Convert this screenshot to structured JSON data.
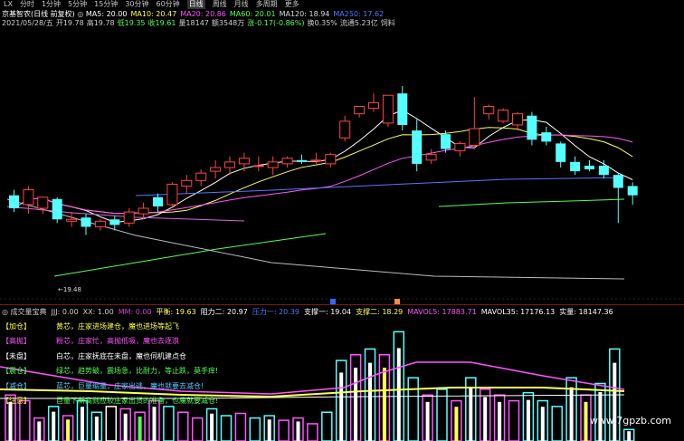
{
  "toolbar": {
    "items": [
      "分时",
      "1分钟",
      "5分钟",
      "15分钟",
      "30分钟",
      "60分钟",
      "日线",
      "周线",
      "月线",
      "多周期",
      "更多"
    ],
    "active_index": 6,
    "prefix": "LX"
  },
  "header": {
    "stock": "京基智农(日线 前复权)",
    "ma": [
      {
        "text": "MA5: 20.00",
        "color": "#ffffff"
      },
      {
        "text": "MA10: 20.47",
        "color": "#ffff55"
      },
      {
        "text": "MA20: 20.86",
        "color": "#ff55ff"
      },
      {
        "text": "MA60: 20.01",
        "color": "#55ff55"
      },
      {
        "text": "MA120: 18.94",
        "color": "#dddddd"
      },
      {
        "text": "MA250: 17.62",
        "color": "#5577ff"
      }
    ],
    "quote_line": [
      {
        "text": "2021/05/28/五",
        "color": "#cccccc"
      },
      {
        "text": "开19.78",
        "color": "#cccccc"
      },
      {
        "text": "高19.78",
        "color": "#cccccc"
      },
      {
        "text": "低19.35",
        "color": "#55ff55"
      },
      {
        "text": "收19.61",
        "color": "#55ff55"
      },
      {
        "text": "量18147",
        "color": "#cccccc"
      },
      {
        "text": "额3548万",
        "color": "#cccccc"
      },
      {
        "text": "涨-0.17(-0.86%)",
        "color": "#55ff55"
      },
      {
        "text": "换0.35%",
        "color": "#cccccc"
      },
      {
        "text": "流通5.23亿",
        "color": "#cccccc"
      },
      {
        "text": "饲料",
        "color": "#cccccc"
      }
    ],
    "min_label": "←19.48"
  },
  "volume_header": [
    {
      "text": "成交量宝典",
      "color": "#cccccc"
    },
    {
      "text": "JJJ: 0.00",
      "color": "#cccccc"
    },
    {
      "text": "XX: 1.00",
      "color": "#cccccc"
    },
    {
      "text": "MM: 0.00",
      "color": "#cc44cc"
    },
    {
      "text": "平衡: 19.63",
      "color": "#ffff55"
    },
    {
      "text": "阻力二: 20.97",
      "color": "#ffffff"
    },
    {
      "text": "压力一: 20.39",
      "color": "#5577ff"
    },
    {
      "text": "支撑一: 19.04",
      "color": "#ffffff"
    },
    {
      "text": "支撑二: 18.29",
      "color": "#ffff55"
    },
    {
      "text": "MAVOL5: 17883.71",
      "color": "#ff55ff"
    },
    {
      "text": "MAVOL35: 17176.13",
      "color": "#ffffff"
    },
    {
      "text": "实量: 18147.36",
      "color": "#ffffff"
    }
  ],
  "legend": [
    {
      "key": "【加仓】",
      "key_color": "#ffff44",
      "desc": "黄芯，庄家进场建仓，魔也进场等起飞",
      "desc_color": "#ffff44"
    },
    {
      "key": "【高抛】",
      "key_color": "#ff55ff",
      "desc": "粉芯，庄家忙，高抛低吸，魔也去逐浪",
      "desc_color": "#ff55ff"
    },
    {
      "key": "【未盘】",
      "key_color": "#ffffff",
      "desc": "白芯，庄家抚底在未盘，魔也伺机建点仓",
      "desc_color": "#ffffff"
    },
    {
      "key": "【震仓】",
      "key_color": "#55ff55",
      "desc": "绿芯，趋势破，震场急，比耐力，等止跌，莫手痒!",
      "desc_color": "#55ff55"
    },
    {
      "key": "【减仓】",
      "key_color": "#55ccff",
      "desc": "蓝芯，巨量缩量，庄家出逃，魔也就要去减仓!",
      "desc_color": "#55ccff"
    },
    {
      "key": "【注意】",
      "key_color": "#ffff44",
      "desc": "巨量下新高则应较庄家出货的准备，也魔就要减仓!",
      "desc_color": "#55ff55"
    }
  ],
  "watermark": "www.7gpzb.com",
  "colors": {
    "up": "#ff4444",
    "down": "#55ffff",
    "ma5": "#ffffff",
    "ma10": "#ffff55",
    "ma20": "#ff55ff",
    "ma60": "#55ff55",
    "ma120": "#dddddd",
    "ma250": "#5577ff"
  },
  "price_axis": {
    "min": 18.0,
    "max": 23.5
  },
  "candles": [
    {
      "o": 20.55,
      "h": 20.7,
      "c": 20.2,
      "l": 20.1
    },
    {
      "o": 20.3,
      "h": 20.8,
      "c": 20.7,
      "l": 20.05
    },
    {
      "o": 20.2,
      "h": 20.45,
      "c": 20.5,
      "l": 20.05
    },
    {
      "o": 20.45,
      "h": 20.5,
      "c": 19.9,
      "l": 19.8
    },
    {
      "o": 19.85,
      "h": 20.1,
      "c": 19.9,
      "l": 19.7
    },
    {
      "o": 19.95,
      "h": 20.05,
      "c": 19.7,
      "l": 19.48
    },
    {
      "o": 19.7,
      "h": 19.9,
      "c": 19.85,
      "l": 19.6
    },
    {
      "o": 19.9,
      "h": 20.0,
      "c": 19.75,
      "l": 19.6
    },
    {
      "o": 19.8,
      "h": 20.2,
      "c": 20.1,
      "l": 19.7
    },
    {
      "o": 20.05,
      "h": 20.35,
      "c": 20.2,
      "l": 19.9
    },
    {
      "o": 20.5,
      "h": 20.6,
      "c": 20.25,
      "l": 20.1
    },
    {
      "o": 20.3,
      "h": 20.9,
      "c": 20.85,
      "l": 20.2
    },
    {
      "o": 20.8,
      "h": 21.1,
      "c": 20.95,
      "l": 20.6
    },
    {
      "o": 20.95,
      "h": 21.25,
      "c": 21.15,
      "l": 20.8
    },
    {
      "o": 21.2,
      "h": 21.5,
      "c": 21.3,
      "l": 21.0
    },
    {
      "o": 21.3,
      "h": 21.6,
      "c": 21.45,
      "l": 21.1
    },
    {
      "o": 21.4,
      "h": 21.7,
      "c": 21.55,
      "l": 21.2
    },
    {
      "o": 21.35,
      "h": 21.6,
      "c": 21.35,
      "l": 21.2
    },
    {
      "o": 21.3,
      "h": 21.6,
      "c": 21.45,
      "l": 21.1
    },
    {
      "o": 21.4,
      "h": 21.6,
      "c": 21.55,
      "l": 21.3
    },
    {
      "o": 21.5,
      "h": 21.65,
      "c": 21.45,
      "l": 21.4
    },
    {
      "o": 21.5,
      "h": 21.7,
      "c": 21.5,
      "l": 21.4
    },
    {
      "o": 21.4,
      "h": 21.7,
      "c": 21.65,
      "l": 21.3
    },
    {
      "o": 22.1,
      "h": 22.7,
      "c": 22.55,
      "l": 22.0
    },
    {
      "o": 22.75,
      "h": 22.9,
      "c": 22.95,
      "l": 22.65
    },
    {
      "o": 22.9,
      "h": 23.3,
      "c": 23.05,
      "l": 22.8
    },
    {
      "o": 22.5,
      "h": 23.1,
      "c": 23.25,
      "l": 22.4
    },
    {
      "o": 23.3,
      "h": 23.5,
      "c": 22.45,
      "l": 22.3
    },
    {
      "o": 22.3,
      "h": 22.6,
      "c": 21.4,
      "l": 21.2
    },
    {
      "o": 21.5,
      "h": 21.8,
      "c": 21.65,
      "l": 21.4
    },
    {
      "o": 22.2,
      "h": 22.3,
      "c": 21.8,
      "l": 21.7
    },
    {
      "o": 21.75,
      "h": 22.0,
      "c": 21.95,
      "l": 21.6
    },
    {
      "o": 21.9,
      "h": 23.2,
      "c": 22.35,
      "l": 21.8
    },
    {
      "o": 22.75,
      "h": 23.0,
      "c": 22.95,
      "l": 22.6
    },
    {
      "o": 22.55,
      "h": 22.9,
      "c": 22.85,
      "l": 22.5
    },
    {
      "o": 22.45,
      "h": 22.8,
      "c": 22.75,
      "l": 22.3
    },
    {
      "o": 22.7,
      "h": 22.8,
      "c": 22.05,
      "l": 21.9
    },
    {
      "o": 22.25,
      "h": 22.4,
      "c": 22.0,
      "l": 21.9
    },
    {
      "o": 21.95,
      "h": 22.0,
      "c": 21.45,
      "l": 21.3
    },
    {
      "o": 21.45,
      "h": 21.6,
      "c": 21.2,
      "l": 21.1
    },
    {
      "o": 21.35,
      "h": 21.5,
      "c": 21.25,
      "l": 21.2
    },
    {
      "o": 21.35,
      "h": 21.5,
      "c": 21.1,
      "l": 21.0
    },
    {
      "o": 21.1,
      "h": 21.15,
      "c": 20.75,
      "l": 19.8
    },
    {
      "o": 20.8,
      "h": 20.9,
      "c": 20.55,
      "l": 20.3
    }
  ],
  "volumes": [
    {
      "v": 0.4,
      "kind": "magenta",
      "core": "white"
    },
    {
      "v": 0.35,
      "kind": "magenta",
      "core": "none"
    },
    {
      "v": 0.2,
      "kind": "magenta",
      "core": "white"
    },
    {
      "v": 0.3,
      "kind": "cyan",
      "core": "white"
    },
    {
      "v": 0.22,
      "kind": "magenta",
      "core": "yellow"
    },
    {
      "v": 0.35,
      "kind": "cyan",
      "core": "white"
    },
    {
      "v": 0.25,
      "kind": "cyan",
      "core": "white"
    },
    {
      "v": 0.3,
      "kind": "white",
      "core": "none"
    },
    {
      "v": 0.28,
      "kind": "magenta",
      "core": "white"
    },
    {
      "v": 0.25,
      "kind": "magenta",
      "core": "green"
    },
    {
      "v": 0.35,
      "kind": "magenta",
      "core": "white"
    },
    {
      "v": 0.3,
      "kind": "cyan",
      "core": "none"
    },
    {
      "v": 0.25,
      "kind": "magenta",
      "core": "none"
    },
    {
      "v": 0.2,
      "kind": "magenta",
      "core": "none"
    },
    {
      "v": 0.28,
      "kind": "cyan",
      "core": "white"
    },
    {
      "v": 0.22,
      "kind": "cyan",
      "core": "none"
    },
    {
      "v": 0.24,
      "kind": "magenta",
      "core": "none"
    },
    {
      "v": 0.2,
      "kind": "cyan",
      "core": "none"
    },
    {
      "v": 0.22,
      "kind": "cyan",
      "core": "white"
    },
    {
      "v": 0.18,
      "kind": "magenta",
      "core": "none"
    },
    {
      "v": 0.2,
      "kind": "magenta",
      "core": "white"
    },
    {
      "v": 0.15,
      "kind": "magenta",
      "core": "none"
    },
    {
      "v": 0.25,
      "kind": "cyan",
      "core": "none"
    },
    {
      "v": 0.7,
      "kind": "cyan",
      "core": "white"
    },
    {
      "v": 0.75,
      "kind": "magenta",
      "core": "white"
    },
    {
      "v": 0.8,
      "kind": "cyan",
      "core": "white"
    },
    {
      "v": 0.75,
      "kind": "magenta",
      "core": "yellow"
    },
    {
      "v": 0.95,
      "kind": "cyan",
      "core": "white"
    },
    {
      "v": 0.55,
      "kind": "cyan",
      "core": "none"
    },
    {
      "v": 0.4,
      "kind": "magenta",
      "core": "white"
    },
    {
      "v": 0.45,
      "kind": "cyan",
      "core": "none"
    },
    {
      "v": 0.35,
      "kind": "magenta",
      "core": "yellow"
    },
    {
      "v": 0.55,
      "kind": "cyan",
      "core": "white"
    },
    {
      "v": 0.45,
      "kind": "magenta",
      "core": "white"
    },
    {
      "v": 0.4,
      "kind": "magenta",
      "core": "white"
    },
    {
      "v": 0.35,
      "kind": "magenta",
      "core": "none"
    },
    {
      "v": 0.42,
      "kind": "cyan",
      "core": "white"
    },
    {
      "v": 0.35,
      "kind": "cyan",
      "core": "white"
    },
    {
      "v": 0.3,
      "kind": "cyan",
      "core": "none"
    },
    {
      "v": 0.55,
      "kind": "cyan",
      "core": "white"
    },
    {
      "v": 0.4,
      "kind": "magenta",
      "core": "yellow"
    },
    {
      "v": 0.5,
      "kind": "cyan",
      "core": "white"
    },
    {
      "v": 0.8,
      "kind": "cyan",
      "core": "white"
    },
    {
      "v": 0.1,
      "kind": "cyan",
      "core": "white"
    }
  ]
}
